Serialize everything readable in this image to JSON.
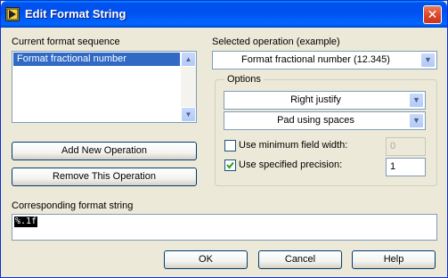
{
  "window": {
    "title": "Edit Format String"
  },
  "current_sequence": {
    "label": "Current format sequence",
    "items": [
      {
        "label": "Format fractional number",
        "selected": true
      }
    ]
  },
  "buttons": {
    "add": "Add New Operation",
    "remove": "Remove This Operation",
    "ok": "OK",
    "cancel": "Cancel",
    "help": "Help"
  },
  "selected_operation": {
    "label": "Selected operation (example)",
    "value": "Format fractional number (12.345)"
  },
  "options": {
    "title": "Options",
    "justify": "Right justify",
    "padding": "Pad using spaces",
    "min_width": {
      "label": "Use minimum field width:",
      "checked": false,
      "value": "0"
    },
    "precision": {
      "label": "Use specified precision:",
      "checked": true,
      "value": "1"
    }
  },
  "format_string": {
    "label": "Corresponding format string",
    "value": "%.1f"
  },
  "colors": {
    "titlebar": "#0053ee",
    "selection": "#316ac5",
    "dialog_bg": "#ece9d8"
  }
}
